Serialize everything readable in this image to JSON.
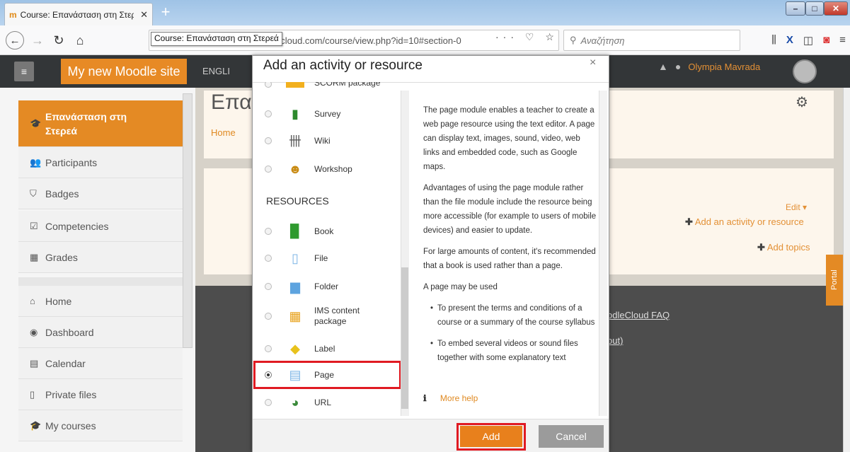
{
  "browser": {
    "tab_title": "Course: Επανάσταση στη Στερεά",
    "tab_favicon": "moodle-favicon",
    "new_tab_label": "+",
    "url": "ecloud.com/course/view.php?id=10#section-0",
    "tooltip": "Course: Επανάσταση στη Στερεά",
    "search_placeholder": "Αναζήτηση",
    "url_actions": "··· ♡ ☆"
  },
  "moodle": {
    "menu_icon": "hamburger-icon",
    "site_name": "My new Moodle site",
    "language": "ENGLI",
    "user_name": "Olympia Mavrada",
    "course_title": "Επα",
    "breadcrumb_home": "Home",
    "edit_label": "Edit",
    "add_activity_label": "Add an activity or resource",
    "add_topics_label": "Add topics",
    "footer_faq": "odleCloud FAQ",
    "footer_logout": "out)",
    "portal_label": "Portal",
    "sidebar": {
      "course": "Επανάσταση στη Στερεά",
      "participants": "Participants",
      "badges": "Badges",
      "competencies": "Competencies",
      "grades": "Grades",
      "home": "Home",
      "dashboard": "Dashboard",
      "calendar": "Calendar",
      "private_files": "Private files",
      "my_courses": "My courses"
    }
  },
  "modal": {
    "title": "Add an activity or resource",
    "close": "×",
    "partial_item": "SCORM package",
    "activities": [
      {
        "label": "Survey",
        "icon": "survey-icon"
      },
      {
        "label": "Wiki",
        "icon": "wiki-icon"
      },
      {
        "label": "Workshop",
        "icon": "workshop-icon"
      }
    ],
    "resources_heading": "RESOURCES",
    "resources": [
      {
        "label": "Book",
        "icon": "book-icon"
      },
      {
        "label": "File",
        "icon": "file-icon"
      },
      {
        "label": "Folder",
        "icon": "folder-icon"
      },
      {
        "label": "IMS content package",
        "icon": "ims-package-icon"
      },
      {
        "label": "Label",
        "icon": "label-icon"
      },
      {
        "label": "Page",
        "icon": "page-icon",
        "selected": true
      },
      {
        "label": "URL",
        "icon": "url-icon"
      }
    ],
    "help": {
      "p1": "The page module enables a teacher to create a web page resource using the text editor. A page can display text, images, sound, video, web links and embedded code, such as Google maps.",
      "p2": "Advantages of using the page module rather than the file module include the resource being more accessible (for example to users of mobile devices) and easier to update.",
      "p3": "For large amounts of content, it's recommended that a book is used rather than a page.",
      "p4": "A page may be used",
      "bullets": [
        "To present the terms and conditions of a course or a summary of the course syllabus",
        "To embed several videos or sound files together with some explanatory text"
      ],
      "more_help": "More help"
    },
    "add_button": "Add",
    "cancel_button": "Cancel"
  },
  "colors": {
    "accent": "#e8801c",
    "highlight": "#e01a22",
    "header_dark": "#333638"
  }
}
